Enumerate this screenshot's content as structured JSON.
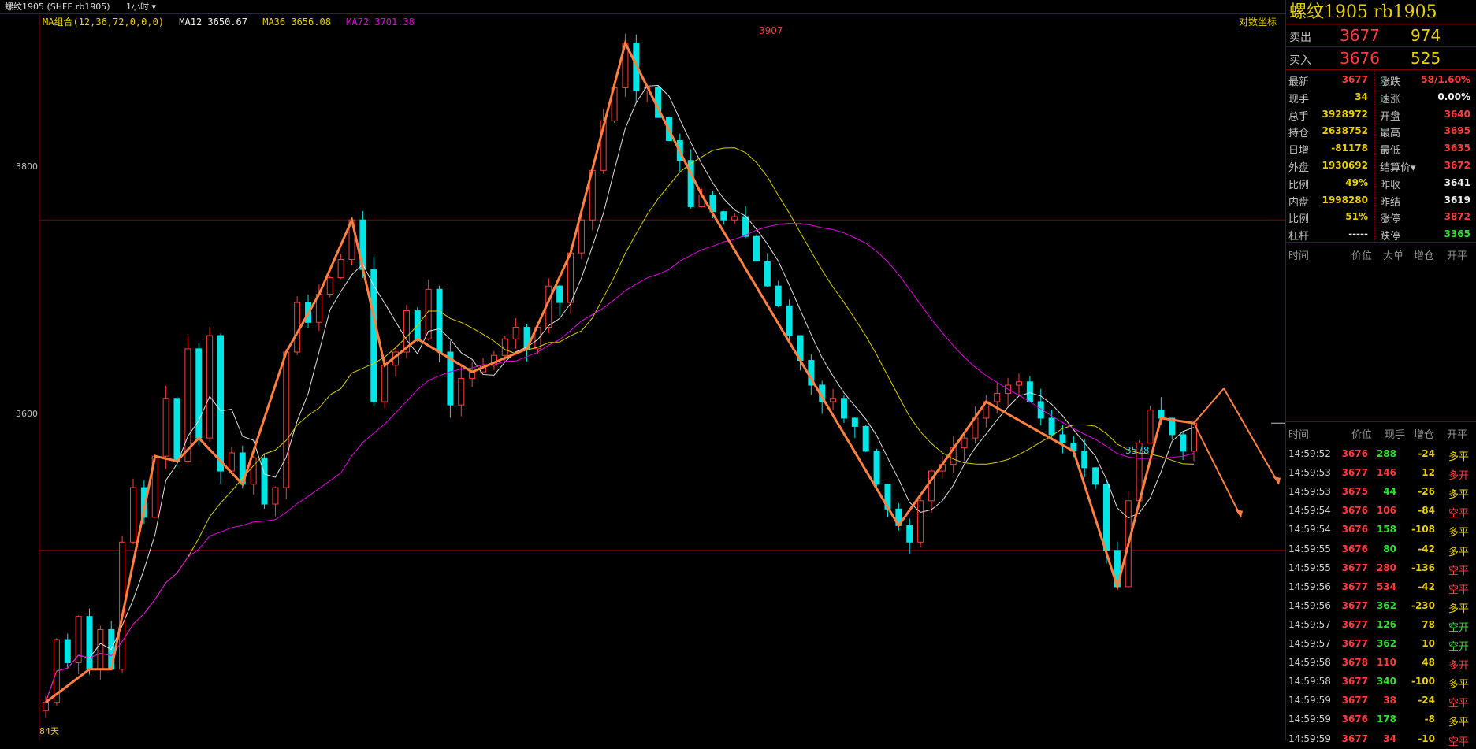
{
  "topbar": {
    "symbol": "螺纹1905 (SHFE rb1905)",
    "period": "1小时"
  },
  "legend": {
    "combo": "MA组合(12,36,72,0,0,0)",
    "ma12": "MA12 3650.67",
    "ma36": "MA36 3656.08",
    "ma72": "MA72 3701.38"
  },
  "log_button": "对数坐标",
  "y_ticks": {
    "upper": "3800",
    "lower": "3600"
  },
  "bottom_label": "84天",
  "peak_label": "3907",
  "low_label": "3578",
  "colors": {
    "up": "#ff3c3c",
    "down": "#00e5e5",
    "zigzag": "#ff8040",
    "ma12": "#e0e0e0",
    "ma36": "#d8d000",
    "ma72": "#e000e0",
    "grid": "#800000"
  },
  "chart_data": {
    "type": "candlestick",
    "ylim": [
      3485,
      3925
    ],
    "y_ticks": [
      3600,
      3800
    ],
    "zigzag": [
      3508,
      3546,
      3532,
      3560,
      3528,
      3552,
      3528,
      3605,
      3638,
      3620,
      3657,
      3692,
      3654,
      3722,
      3668,
      3730,
      3648,
      3659,
      3640,
      3656,
      3628,
      3638,
      3720,
      3750,
      3738,
      3755,
      3765,
      3776,
      3800,
      3770,
      3690,
      3712,
      3720,
      3745,
      3728,
      3758,
      3720,
      3688,
      3704,
      3708,
      3712,
      3718,
      3728,
      3735,
      3722,
      3735,
      3760,
      3750,
      3780,
      3800,
      3830,
      3860,
      3880,
      3907,
      3878,
      3880,
      3862,
      3848,
      3836,
      3808,
      3815,
      3805,
      3800,
      3802,
      3790,
      3775,
      3760,
      3748,
      3730,
      3715,
      3700,
      3690,
      3692,
      3680,
      3675,
      3660,
      3640,
      3625,
      3615,
      3605,
      3630,
      3648,
      3652,
      3662,
      3668,
      3680,
      3690,
      3695,
      3700,
      3702,
      3690,
      3680,
      3670,
      3665,
      3660,
      3650,
      3640,
      3600,
      3578,
      3630,
      3665,
      3685,
      3680,
      3670,
      3660,
      3677
    ],
    "projection_line": [
      3677,
      3698,
      3650
    ],
    "projection_arrows": [
      [
        3698,
        3630
      ],
      [
        3698,
        3615
      ]
    ]
  },
  "panel": {
    "title": "螺纹1905  rb1905",
    "ask": {
      "label": "卖出",
      "price": "3677",
      "vol": "974"
    },
    "bid": {
      "label": "买入",
      "price": "3676",
      "vol": "525"
    },
    "stats": [
      {
        "l1": "最新",
        "v1": "3677",
        "c1": "red",
        "l2": "涨跌",
        "v2": "58/1.60%",
        "c2": "red"
      },
      {
        "l1": "现手",
        "v1": "34",
        "c1": "yellow",
        "l2": "速涨",
        "v2": "0.00%",
        "c2": "white"
      },
      {
        "l1": "总手",
        "v1": "3928972",
        "c1": "yellow",
        "l2": "开盘",
        "v2": "3640",
        "c2": "red"
      },
      {
        "l1": "持仓",
        "v1": "2638752",
        "c1": "yellow",
        "l2": "最高",
        "v2": "3695",
        "c2": "red"
      },
      {
        "l1": "日增",
        "v1": "-81178",
        "c1": "yellow",
        "l2": "最低",
        "v2": "3635",
        "c2": "red"
      },
      {
        "l1": "外盘",
        "v1": "1930692",
        "c1": "yellow",
        "l2": "结算价▾",
        "v2": "3672",
        "c2": "red"
      },
      {
        "l1": "比例",
        "v1": "49%",
        "c1": "yellow",
        "l2": "昨收",
        "v2": "3641",
        "c2": "white"
      },
      {
        "l1": "内盘",
        "v1": "1998280",
        "c1": "yellow",
        "l2": "昨结",
        "v2": "3619",
        "c2": "white"
      },
      {
        "l1": "比例",
        "v1": "51%",
        "c1": "yellow",
        "l2": "涨停",
        "v2": "3872",
        "c2": "red"
      },
      {
        "l1": "杠杆",
        "v1": "-----",
        "c1": "white",
        "l2": "跌停",
        "v2": "3365",
        "c2": "green"
      }
    ],
    "big_head": {
      "time": "时间",
      "price": "价位",
      "big": "大单",
      "oi": "增仓",
      "type": "开平"
    },
    "tick_head": {
      "time": "时间",
      "price": "价位",
      "now": "现手",
      "oi": "增仓",
      "type": "开平"
    },
    "ticks": [
      {
        "time": "14:59:52",
        "price": "3676",
        "now": "288",
        "nc": "green",
        "oi": "-24",
        "type": "多平",
        "tc": "yellow"
      },
      {
        "time": "14:59:53",
        "price": "3677",
        "now": "146",
        "nc": "red",
        "oi": "12",
        "type": "多开",
        "tc": "red"
      },
      {
        "time": "14:59:53",
        "price": "3675",
        "now": "44",
        "nc": "green",
        "oi": "-26",
        "type": "多平",
        "tc": "yellow"
      },
      {
        "time": "14:59:54",
        "price": "3676",
        "now": "106",
        "nc": "red",
        "oi": "-84",
        "type": "空平",
        "tc": "red"
      },
      {
        "time": "14:59:54",
        "price": "3676",
        "now": "158",
        "nc": "green",
        "oi": "-108",
        "type": "多平",
        "tc": "yellow"
      },
      {
        "time": "14:59:55",
        "price": "3676",
        "now": "80",
        "nc": "green",
        "oi": "-42",
        "type": "多平",
        "tc": "yellow"
      },
      {
        "time": "14:59:55",
        "price": "3677",
        "now": "280",
        "nc": "red",
        "oi": "-136",
        "type": "空平",
        "tc": "red"
      },
      {
        "time": "14:59:56",
        "price": "3677",
        "now": "534",
        "nc": "red",
        "oi": "-42",
        "type": "空平",
        "tc": "red"
      },
      {
        "time": "14:59:56",
        "price": "3677",
        "now": "362",
        "nc": "green",
        "oi": "-230",
        "type": "多平",
        "tc": "yellow"
      },
      {
        "time": "14:59:57",
        "price": "3677",
        "now": "126",
        "nc": "green",
        "oi": "78",
        "type": "空开",
        "tc": "green"
      },
      {
        "time": "14:59:57",
        "price": "3677",
        "now": "362",
        "nc": "green",
        "oi": "10",
        "type": "空开",
        "tc": "green"
      },
      {
        "time": "14:59:58",
        "price": "3678",
        "now": "110",
        "nc": "red",
        "oi": "48",
        "type": "多开",
        "tc": "red"
      },
      {
        "time": "14:59:58",
        "price": "3677",
        "now": "340",
        "nc": "green",
        "oi": "-100",
        "type": "多平",
        "tc": "yellow"
      },
      {
        "time": "14:59:59",
        "price": "3677",
        "now": "38",
        "nc": "red",
        "oi": "-24",
        "type": "空平",
        "tc": "red"
      },
      {
        "time": "14:59:59",
        "price": "3676",
        "now": "178",
        "nc": "green",
        "oi": "-8",
        "type": "多平",
        "tc": "yellow"
      },
      {
        "time": "14:59:59",
        "price": "3677",
        "now": "34",
        "nc": "red",
        "oi": "-10",
        "type": "空平",
        "tc": "red"
      }
    ]
  }
}
